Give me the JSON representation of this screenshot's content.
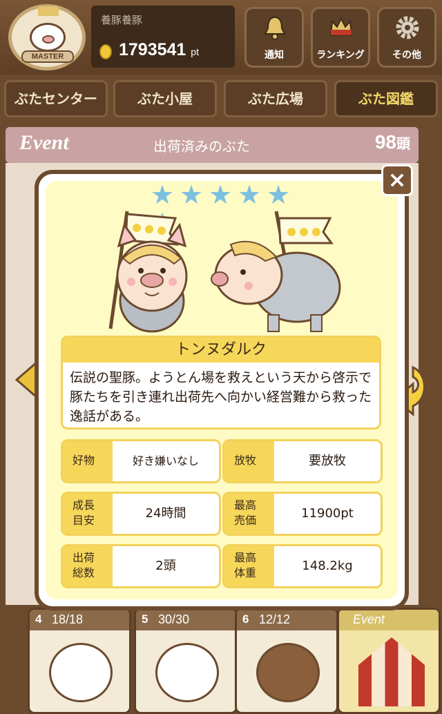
{
  "header": {
    "avatar_label": "MASTER",
    "username": "養豚養豚",
    "points": "1793541",
    "points_unit": "pt",
    "buttons": [
      {
        "label": "通知",
        "icon": "bell-icon"
      },
      {
        "label": "ランキング",
        "icon": "crown-icon"
      },
      {
        "label": "その他",
        "icon": "gear-icon"
      }
    ]
  },
  "nav": {
    "tabs": [
      {
        "label": "ぶたセンター",
        "active": false
      },
      {
        "label": "ぶた小屋",
        "active": false
      },
      {
        "label": "ぶた広場",
        "active": false
      },
      {
        "label": "ぶた図鑑",
        "active": true
      }
    ]
  },
  "event_bar": {
    "tag": "Event",
    "title": "出荷済みのぶた",
    "count": "98",
    "count_unit": "頭"
  },
  "modal": {
    "rarity_stars": 6,
    "close": "×",
    "pig_name": "トンヌダルク",
    "description": "伝説の聖豚。ようとん場を救えという天から啓示で豚たちを引き連れ出荷先へ向かい経営難から救った逸話がある。",
    "stats": {
      "likes_label": "好物",
      "likes_value": "好き嫌いなし",
      "grazing_label": "放牧",
      "grazing_value": "要放牧",
      "growth_label": "成長目安",
      "growth_value": "24時間",
      "max_price_label": "最高売価",
      "max_price_value": "11900pt",
      "shipped_label": "出荷総数",
      "shipped_value": "2頭",
      "max_weight_label": "最高体重",
      "max_weight_value": "148.2kg"
    }
  },
  "cards": [
    {
      "num": "4",
      "count": "18/18"
    },
    {
      "num": "5",
      "count": "30/30"
    },
    {
      "num": "6",
      "count": "12/12"
    },
    {
      "num": "",
      "count": "Event"
    }
  ],
  "colors": {
    "brown": "#6b4a2e",
    "modal_bg": "#fffbc4",
    "label_yellow": "#f7d75a",
    "star_blue": "#7cc0e0"
  }
}
